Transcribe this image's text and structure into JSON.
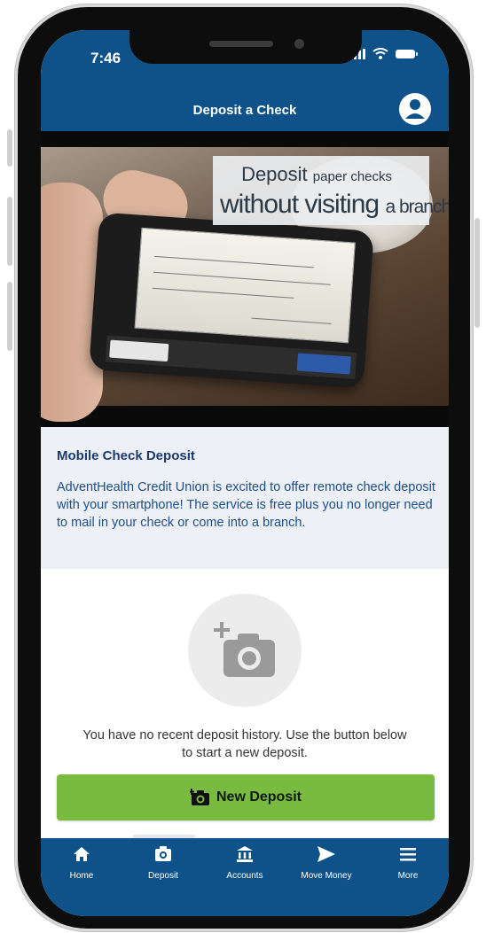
{
  "status_bar": {
    "time": "7:46"
  },
  "header": {
    "title": "Deposit a Check"
  },
  "hero": {
    "banner_line1_main": "Deposit",
    "banner_line1_small": "paper checks",
    "banner_line2_main": "without visiting",
    "banner_line2_small": "a branch",
    "banner_bang": "!"
  },
  "info": {
    "title": "Mobile Check Deposit",
    "body": "AdventHealth Credit Union is excited to offer remote check deposit with your smartphone! The service is free plus you no longer need to mail in your check or come into a branch."
  },
  "empty_state": {
    "message": "You have no recent deposit history. Use the button below to start a new deposit."
  },
  "actions": {
    "new_deposit_label": "New Deposit"
  },
  "tabs": [
    {
      "label": "Home",
      "icon": "home-icon"
    },
    {
      "label": "Deposit",
      "icon": "camera-icon"
    },
    {
      "label": "Accounts",
      "icon": "bank-icon"
    },
    {
      "label": "Move Money",
      "icon": "send-icon"
    },
    {
      "label": "More",
      "icon": "menu-icon"
    }
  ],
  "colors": {
    "brand_blue": "#0f5289",
    "deposit_green": "#79bb41",
    "info_background": "#edf0f6"
  }
}
